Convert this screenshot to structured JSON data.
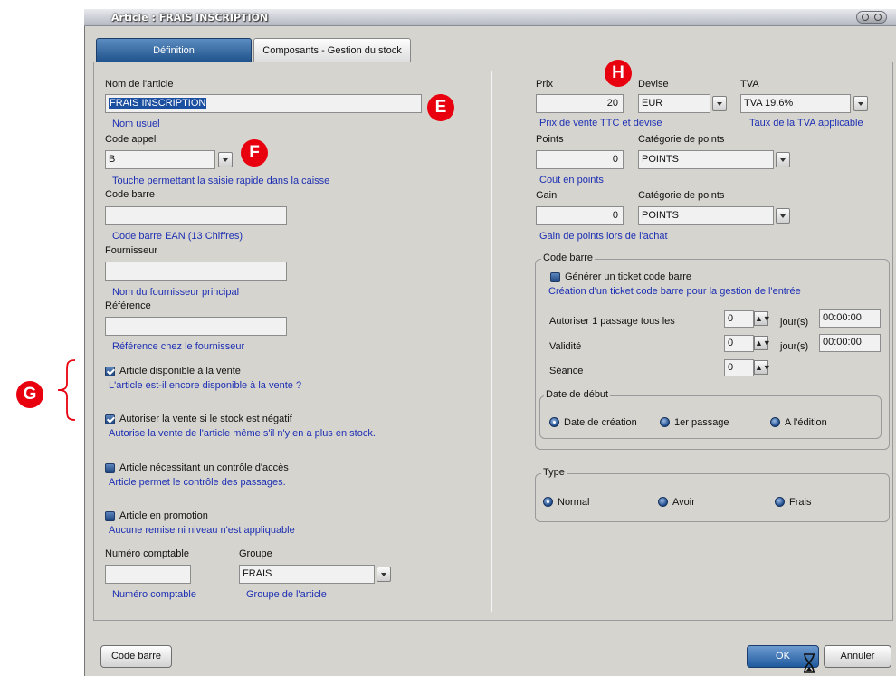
{
  "window": {
    "title": "Article : FRAIS INSCRIPTION"
  },
  "tabs": [
    {
      "label": "Définition",
      "active": true
    },
    {
      "label": "Composants - Gestion du stock",
      "active": false
    }
  ],
  "left": {
    "nom": {
      "label": "Nom de l'article",
      "value": "FRAIS INSCRIPTION",
      "hint": "Nom usuel"
    },
    "code_appel": {
      "label": "Code appel",
      "value": "B",
      "hint": "Touche permettant la saisie rapide dans la caisse"
    },
    "code_barre": {
      "label": "Code barre",
      "value": "",
      "hint": "Code barre EAN (13 Chiffres)"
    },
    "fournisseur": {
      "label": "Fournisseur",
      "value": "",
      "hint": "Nom du fournisseur principal"
    },
    "reference": {
      "label": "Référence",
      "value": "",
      "hint": "Référence chez le fournisseur"
    },
    "checks": [
      {
        "label": "Article disponible à la vente",
        "hint": "L'article est-il encore disponible à la vente ?",
        "checked": true
      },
      {
        "label": "Autoriser la vente si le stock est négatif",
        "hint": "Autorise la vente de l'article même s'il n'y en a plus en stock.",
        "checked": true
      },
      {
        "label": "Article nécessitant un contrôle d'accès",
        "hint": "Article permet le contrôle des passages.",
        "checked": false
      },
      {
        "label": "Article en promotion",
        "hint": "Aucune remise ni niveau n'est appliquable",
        "checked": false
      }
    ],
    "numero_comptable": {
      "label": "Numéro comptable",
      "value": "",
      "hint": "Numéro comptable"
    },
    "groupe": {
      "label": "Groupe",
      "value": "FRAIS",
      "hint": "Groupe de l'article"
    }
  },
  "right": {
    "prix": {
      "label": "Prix",
      "value": "20"
    },
    "devise": {
      "label": "Devise",
      "value": "EUR"
    },
    "prix_hint": "Prix de vente TTC et devise",
    "tva": {
      "label": "TVA",
      "value": "TVA 19.6%",
      "hint": "Taux de la TVA applicable"
    },
    "points": {
      "label": "Points",
      "value": "0",
      "hint": "Coût en points"
    },
    "cat_points_1": {
      "label": "Catégorie de points",
      "value": "POINTS"
    },
    "gain": {
      "label": "Gain",
      "value": "0",
      "hint": "Gain de points lors de l'achat"
    },
    "cat_points_2": {
      "label": "Catégorie de points",
      "value": "POINTS"
    },
    "code_barre_group": {
      "legend": "Code barre",
      "generer": {
        "label": "Générer un ticket code barre",
        "checked": false
      },
      "hint": "Création d'un ticket code barre pour la gestion de l'entrée",
      "autoriser": {
        "label": "Autoriser 1 passage tous les",
        "value": "0",
        "unit": "jour(s)",
        "time": "00:00:00"
      },
      "validite": {
        "label": "Validité",
        "value": "0",
        "unit": "jour(s)",
        "time": "00:00:00"
      },
      "seance": {
        "label": "Séance",
        "value": "0"
      },
      "date_debut": {
        "legend": "Date de début",
        "options": [
          "Date de création",
          "1er passage",
          "A l'édition"
        ],
        "selected": 0
      }
    },
    "type_group": {
      "legend": "Type",
      "options": [
        "Normal",
        "Avoir",
        "Frais"
      ],
      "selected": 0
    }
  },
  "footer": {
    "code_barre_btn": "Code barre",
    "ok_btn": "OK",
    "annuler_btn": "Annuler"
  },
  "annotations": {
    "e": "E",
    "f": "F",
    "g": "G",
    "h": "H"
  },
  "colors": {
    "hint": "#1c2fb4",
    "badge": "#e8000f",
    "accent": "#21548d"
  }
}
